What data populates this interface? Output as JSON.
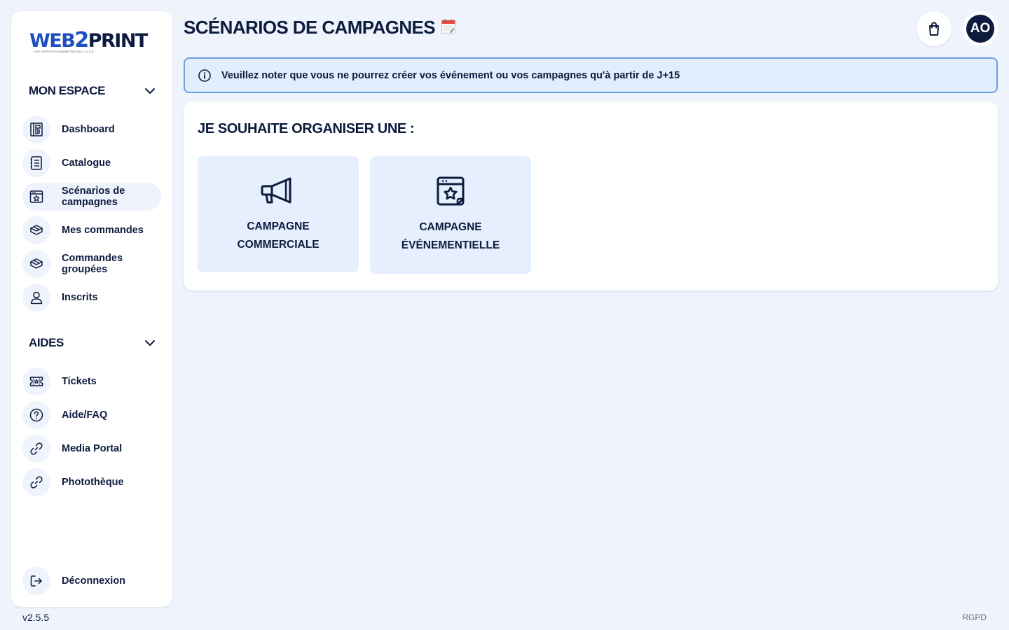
{
  "app": {
    "logo_main_web": "WEB",
    "logo_main_two": "2",
    "logo_main_print": "PRINT",
    "logo_sub": "VOS SUPPORTS MARKETING EN 3 CLICS",
    "version": "v2.5.5",
    "footer_link": "RGPD"
  },
  "sidebar": {
    "sections": [
      {
        "title": "MON ESPACE",
        "items": [
          {
            "label": "Dashboard",
            "icon": "dashboard-icon"
          },
          {
            "label": "Catalogue",
            "icon": "catalogue-icon"
          },
          {
            "label": "Scénarios de campagnes",
            "icon": "calendar-star-icon",
            "active": true
          },
          {
            "label": "Mes commandes",
            "icon": "box-icon"
          },
          {
            "label": "Commandes groupées",
            "icon": "box-icon"
          },
          {
            "label": "Inscrits",
            "icon": "user-icon"
          }
        ]
      },
      {
        "title": "AIDES",
        "items": [
          {
            "label": "Tickets",
            "icon": "ticket-icon"
          },
          {
            "label": "Aide/FAQ",
            "icon": "question-icon"
          },
          {
            "label": "Media Portal",
            "icon": "link-icon"
          },
          {
            "label": "Photothèque",
            "icon": "link-icon"
          }
        ]
      }
    ],
    "logout_label": "Déconnexion"
  },
  "header": {
    "title": "SCÉNARIOS DE CAMPAGNES",
    "avatar_initials": "AO"
  },
  "notice": {
    "text": "Veuillez noter que vous ne pourrez créer vos événement ou vos campagnes qu'à partir de J+15"
  },
  "main": {
    "heading": "JE SOUHAITE ORGANISER UNE :",
    "options": [
      {
        "label": "CAMPAGNE COMMERCIALE",
        "icon": "megaphone-icon"
      },
      {
        "label": "CAMPAGNE ÉVÉNEMENTIELLE",
        "icon": "calendar-star-icon"
      }
    ]
  },
  "colors": {
    "background": "#eef3fc",
    "navy": "#0d1b3e",
    "brand_blue": "#1f4fbf",
    "notice_border": "#6aa1e6",
    "option_bg": "#e6effd"
  }
}
